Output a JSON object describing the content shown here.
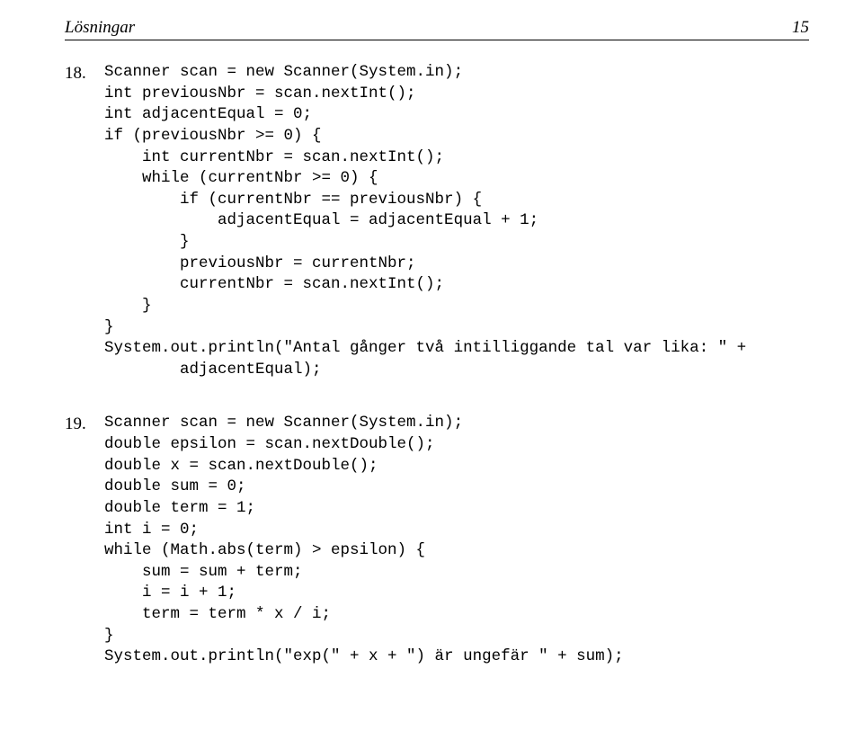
{
  "header": {
    "title": "Lösningar",
    "page_number": "15"
  },
  "problems": [
    {
      "number": "18.",
      "code": "Scanner scan = new Scanner(System.in);\nint previousNbr = scan.nextInt();\nint adjacentEqual = 0;\nif (previousNbr >= 0) {\n    int currentNbr = scan.nextInt();\n    while (currentNbr >= 0) {\n        if (currentNbr == previousNbr) {\n            adjacentEqual = adjacentEqual + 1;\n        }\n        previousNbr = currentNbr;\n        currentNbr = scan.nextInt();\n    }\n}\nSystem.out.println(\"Antal gånger två intilliggande tal var lika: \" +\n        adjacentEqual);"
    },
    {
      "number": "19.",
      "code": "Scanner scan = new Scanner(System.in);\ndouble epsilon = scan.nextDouble();\ndouble x = scan.nextDouble();\ndouble sum = 0;\ndouble term = 1;\nint i = 0;\nwhile (Math.abs(term) > epsilon) {\n    sum = sum + term;\n    i = i + 1;\n    term = term * x / i;\n}\nSystem.out.println(\"exp(\" + x + \") är ungefär \" + sum);"
    }
  ]
}
